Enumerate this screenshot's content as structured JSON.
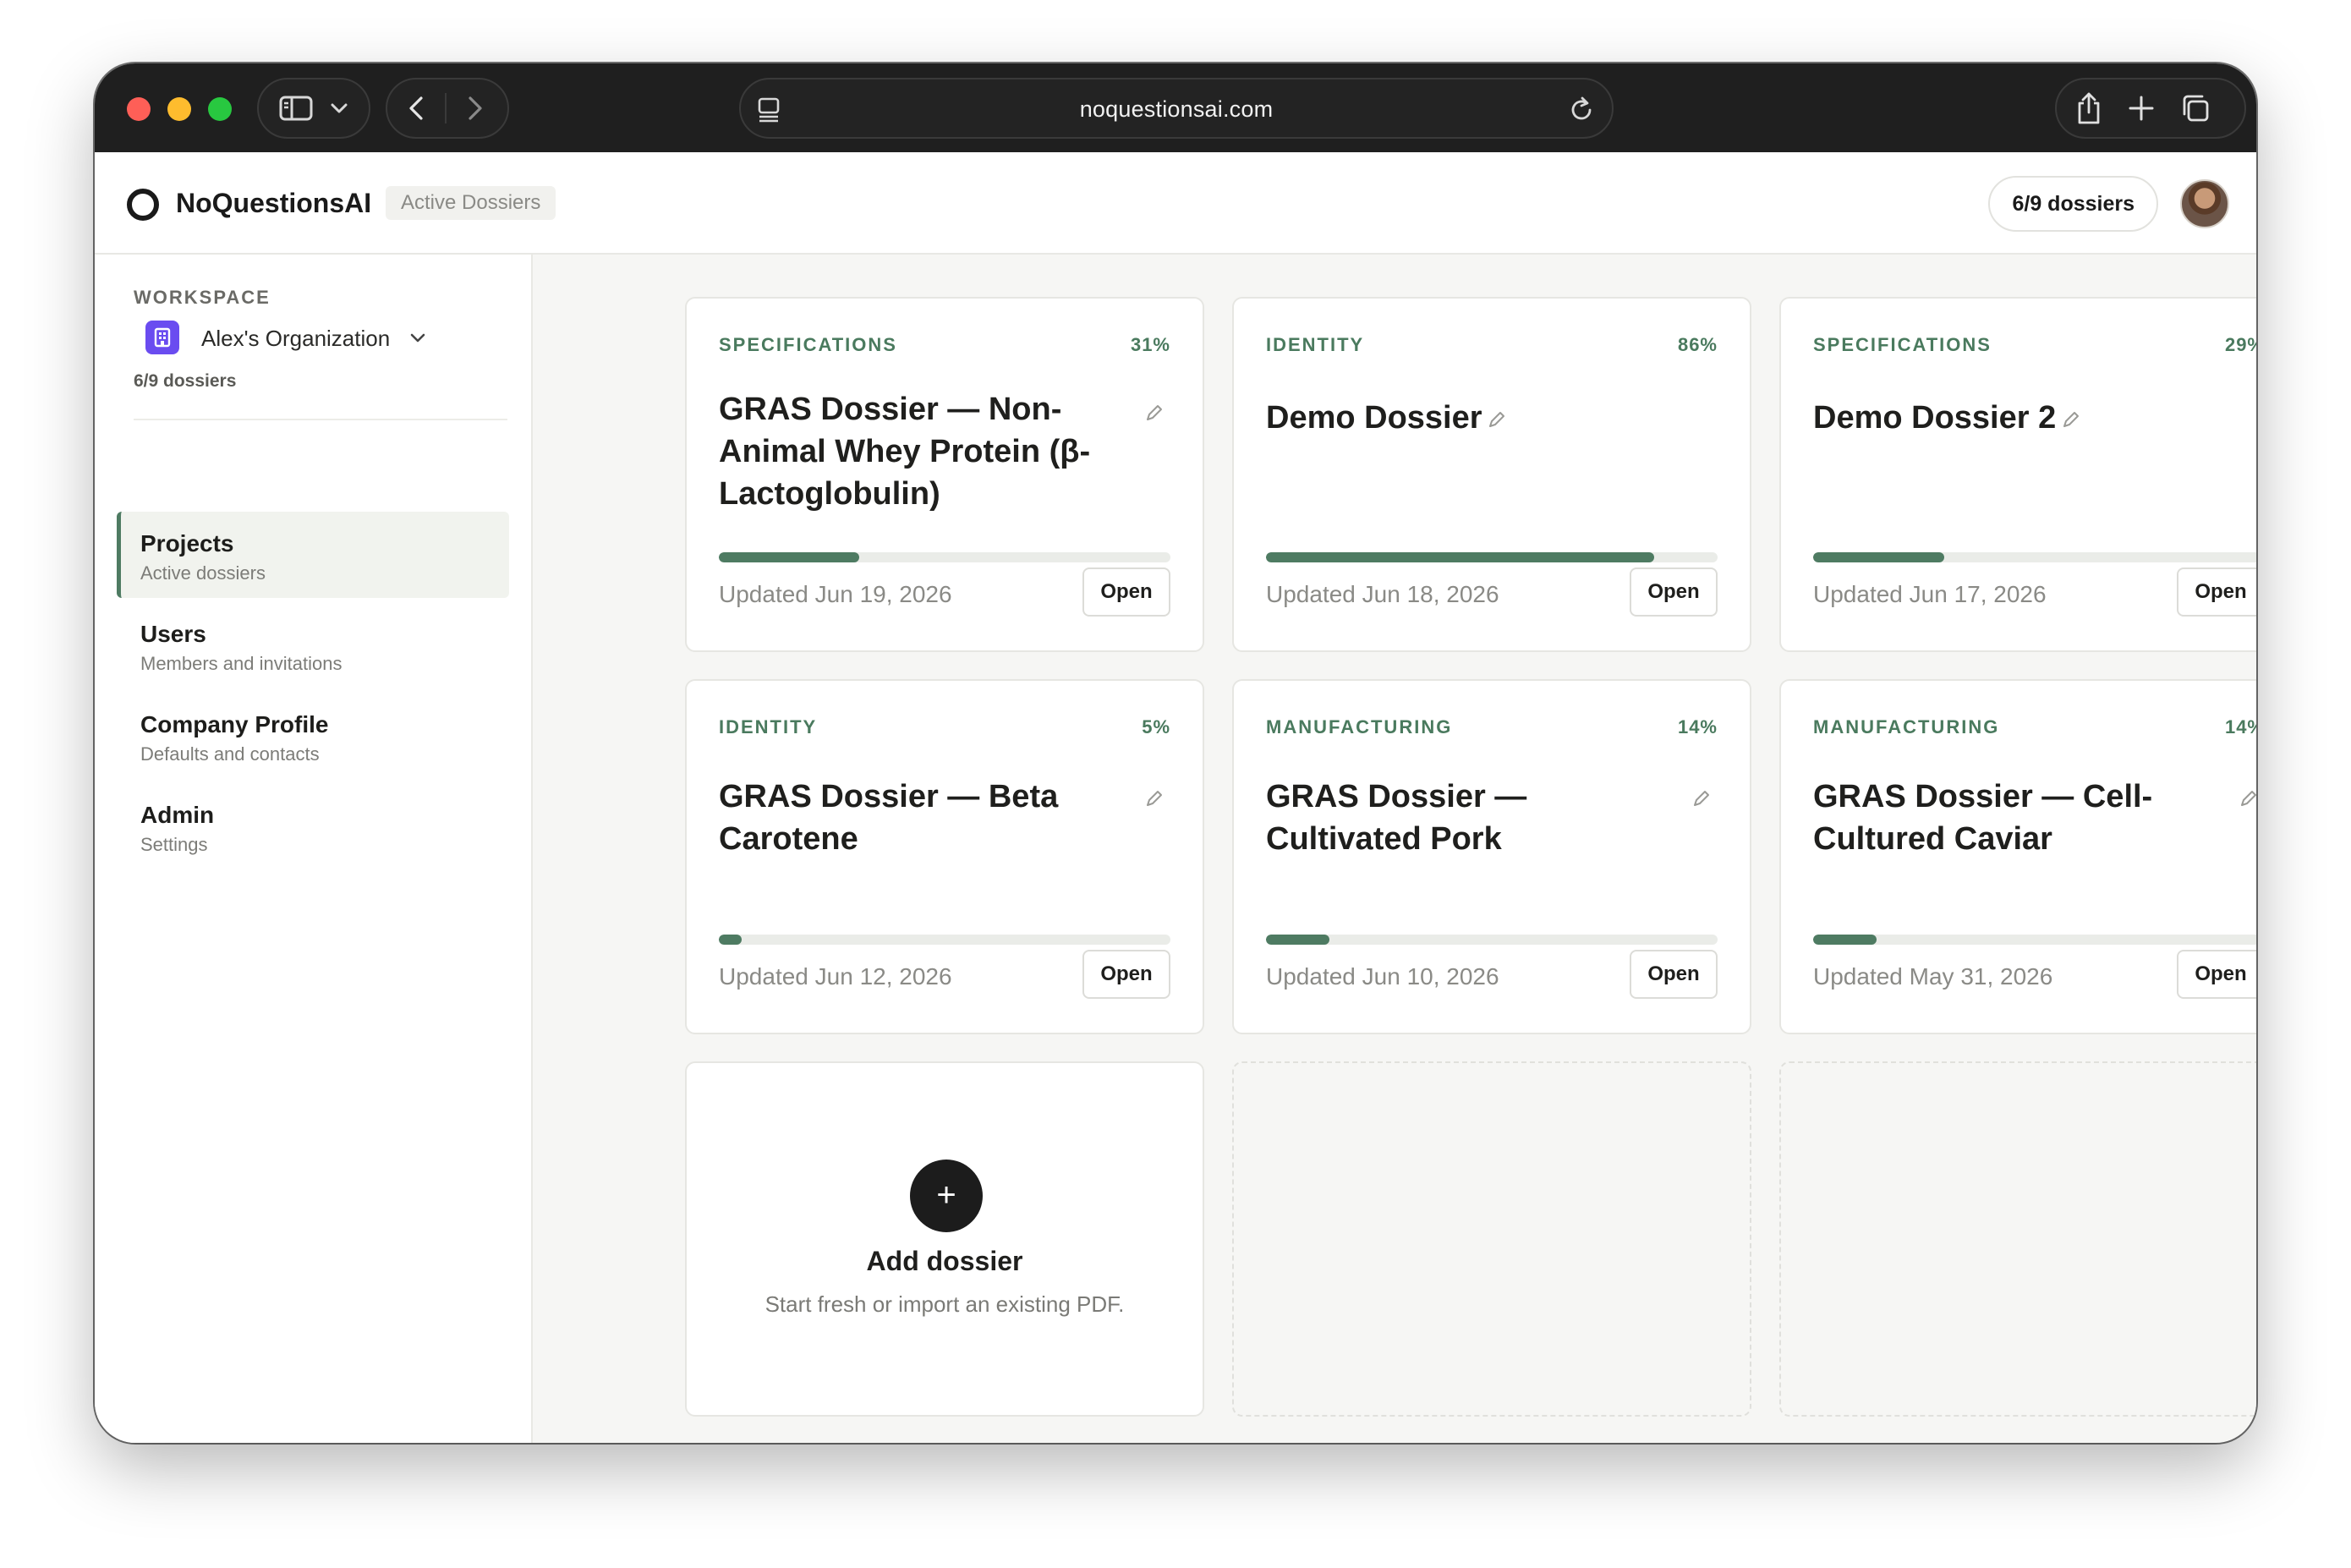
{
  "browser": {
    "url": "noquestionsai.com"
  },
  "header": {
    "brand": "NoQuestionsAI",
    "breadcrumb": "Active Dossiers",
    "quota": "6/9 dossiers"
  },
  "sidebar": {
    "workspace_label": "WORKSPACE",
    "org_name": "Alex's Organization",
    "org_count": "6/9 dossiers",
    "items": [
      {
        "title": "Projects",
        "subtitle": "Active dossiers"
      },
      {
        "title": "Users",
        "subtitle": "Members and invitations"
      },
      {
        "title": "Company Profile",
        "subtitle": "Defaults and contacts"
      },
      {
        "title": "Admin",
        "subtitle": "Settings"
      }
    ]
  },
  "cards": [
    {
      "category": "SPECIFICATIONS",
      "percent": "31%",
      "progress": 0.31,
      "title": "GRAS Dossier — Non-Animal Whey Protein (β-Lactoglobulin)",
      "updated": "Updated Jun 19, 2026",
      "action": "Open"
    },
    {
      "category": "IDENTITY",
      "percent": "86%",
      "progress": 0.86,
      "title": "Demo Dossier",
      "updated": "Updated Jun 18, 2026",
      "action": "Open"
    },
    {
      "category": "SPECIFICATIONS",
      "percent": "29%",
      "progress": 0.29,
      "title": "Demo Dossier 2",
      "updated": "Updated Jun 17, 2026",
      "action": "Open"
    },
    {
      "category": "IDENTITY",
      "percent": "5%",
      "progress": 0.05,
      "title": "GRAS Dossier — Beta Carotene",
      "updated": "Updated Jun 12, 2026",
      "action": "Open"
    },
    {
      "category": "MANUFACTURING",
      "percent": "14%",
      "progress": 0.14,
      "title": "GRAS Dossier — Cultivated Pork",
      "updated": "Updated Jun 10, 2026",
      "action": "Open"
    },
    {
      "category": "MANUFACTURING",
      "percent": "14%",
      "progress": 0.14,
      "title": "GRAS Dossier — Cell-Cultured Caviar",
      "updated": "Updated May 31, 2026",
      "action": "Open"
    }
  ],
  "add_card": {
    "icon": "+",
    "title": "Add dossier",
    "subtitle": "Start fresh or import an existing PDF."
  },
  "colors": {
    "accent": "#4e7b62",
    "org_badge": "#6a4cf0"
  }
}
